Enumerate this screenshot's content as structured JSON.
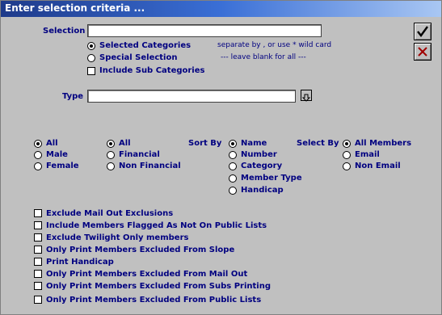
{
  "window_title": "Enter selection criteria ...",
  "selection": {
    "label": "Selection",
    "value": ""
  },
  "category_mode": {
    "options": [
      "Selected Categories",
      "Special Selection"
    ],
    "selected": "Selected Categories",
    "note1": "separate by , or use * wild card",
    "note2": "---   leave blank for all   ---"
  },
  "include_sub": {
    "label": "Include Sub Categories",
    "checked": false
  },
  "type": {
    "label": "Type",
    "value": ""
  },
  "gender": {
    "options": [
      "All",
      "Male",
      "Female"
    ],
    "selected": "All"
  },
  "financial": {
    "options": [
      "All",
      "Financial",
      "Non Financial"
    ],
    "selected": "All"
  },
  "sort_by": {
    "label": "Sort By",
    "options": [
      "Name",
      "Number",
      "Category",
      "Member Type",
      "Handicap"
    ],
    "selected": "Name"
  },
  "select_by": {
    "label": "Select By",
    "options": [
      "All Members",
      "Email",
      "Non Email"
    ],
    "selected": "All Members"
  },
  "checkboxes": [
    {
      "label": "Exclude Mail Out Exclusions",
      "checked": false
    },
    {
      "label": "Include Members Flagged As Not On Public Lists",
      "checked": false
    },
    {
      "label": "Exclude Twilight Only members",
      "checked": false
    },
    {
      "label": "Only Print Members Excluded From Slope",
      "checked": false
    },
    {
      "label": "Print Handicap",
      "checked": false
    },
    {
      "label": "Only Print Members Excluded From Mail Out",
      "checked": false
    },
    {
      "label": "Only Print Members Excluded From Subs Printing",
      "checked": false
    },
    {
      "label": "Only Print Members Excluded From Public Lists",
      "checked": false
    }
  ],
  "icons": {
    "ok": "checkmark-icon",
    "cancel": "cross-icon",
    "dropdown": "arrow-down-icon"
  }
}
